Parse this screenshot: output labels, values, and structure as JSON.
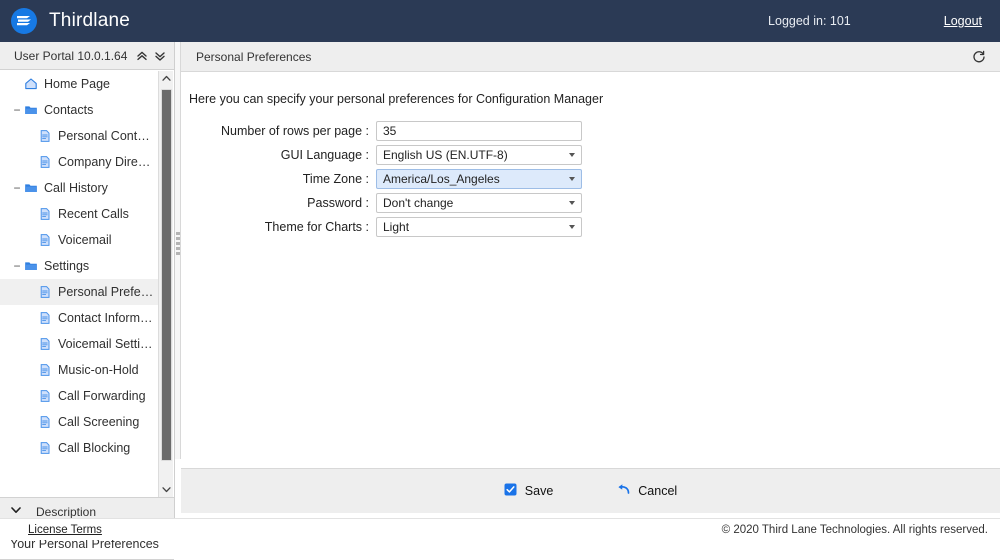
{
  "header": {
    "brand": "Thirdlane",
    "logo_icon": "thirdlane-logo-icon",
    "logged_in_label": "Logged in: 101",
    "logout_label": "Logout",
    "background_color": "#2b3a55",
    "accent_color": "#1779e4"
  },
  "sidebar": {
    "portal_title": "User Portal 10.0.1.64",
    "collapse_all_icon": "double-chevron-up-icon",
    "expand_all_icon": "double-chevron-down-icon",
    "tree": [
      {
        "label": "Home Page",
        "icon": "home-icon",
        "level": 0,
        "toggle": "",
        "selected": false
      },
      {
        "label": "Contacts",
        "icon": "folder-icon",
        "level": 1,
        "toggle": "−",
        "selected": false
      },
      {
        "label": "Personal Contacts",
        "icon": "document-icon",
        "level": 2,
        "toggle": "",
        "selected": false
      },
      {
        "label": "Company Directory",
        "icon": "document-icon",
        "level": 2,
        "toggle": "",
        "selected": false
      },
      {
        "label": "Call History",
        "icon": "folder-icon",
        "level": 1,
        "toggle": "−",
        "selected": false
      },
      {
        "label": "Recent Calls",
        "icon": "document-icon",
        "level": 2,
        "toggle": "",
        "selected": false
      },
      {
        "label": "Voicemail",
        "icon": "document-icon",
        "level": 2,
        "toggle": "",
        "selected": false
      },
      {
        "label": "Settings",
        "icon": "folder-icon",
        "level": 1,
        "toggle": "−",
        "selected": false
      },
      {
        "label": "Personal Preferenc…",
        "icon": "document-icon",
        "level": 2,
        "toggle": "",
        "selected": true
      },
      {
        "label": "Contact Information",
        "icon": "document-icon",
        "level": 2,
        "toggle": "",
        "selected": false
      },
      {
        "label": "Voicemail Settings",
        "icon": "document-icon",
        "level": 2,
        "toggle": "",
        "selected": false
      },
      {
        "label": "Music-on-Hold",
        "icon": "document-icon",
        "level": 2,
        "toggle": "",
        "selected": false
      },
      {
        "label": "Call Forwarding",
        "icon": "document-icon",
        "level": 2,
        "toggle": "",
        "selected": false
      },
      {
        "label": "Call Screening",
        "icon": "document-icon",
        "level": 2,
        "toggle": "",
        "selected": false
      },
      {
        "label": "Call Blocking",
        "icon": "document-icon",
        "level": 2,
        "toggle": "",
        "selected": false
      }
    ],
    "description": {
      "header_label": "Description",
      "collapse_icon": "chevron-down-icon",
      "text": "Your Personal Preferences"
    }
  },
  "content": {
    "title": "Personal Preferences",
    "refresh_icon": "refresh-icon",
    "intro": "Here you can specify your personal preferences for Configuration Manager",
    "fields": [
      {
        "label": "Number of rows per page :",
        "value": "35",
        "type": "text",
        "focused": false
      },
      {
        "label": "GUI Language :",
        "value": "English US (EN.UTF-8)",
        "type": "select",
        "focused": false
      },
      {
        "label": "Time Zone :",
        "value": "America/Los_Angeles",
        "type": "select",
        "focused": true
      },
      {
        "label": "Password :",
        "value": "Don't change",
        "type": "select",
        "focused": false
      },
      {
        "label": "Theme for Charts :",
        "value": "Light",
        "type": "select",
        "focused": false
      }
    ],
    "actions": {
      "save_label": "Save",
      "save_icon": "save-check-icon",
      "cancel_label": "Cancel",
      "cancel_icon": "undo-arrow-icon"
    }
  },
  "footer": {
    "license_label": "License Terms",
    "copyright": "© 2020 Third Lane Technologies. All rights reserved."
  }
}
